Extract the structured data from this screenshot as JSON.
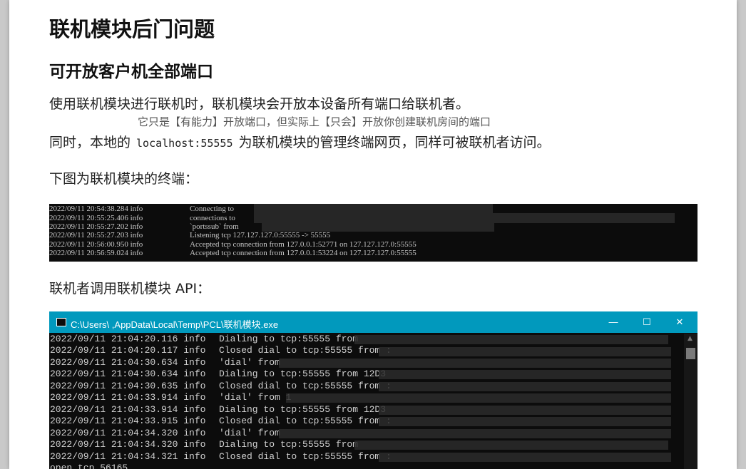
{
  "heading": "联机模块后门问题",
  "subheading": "可开放客户机全部端口",
  "para1": "使用联机模块进行联机时，联机模块会开放本设备所有端口给联机者。",
  "note": "它只是【有能力】开放端口，但实际上【只会】开放你创建联机房间的端口",
  "para2": {
    "before": "同时，本地的",
    "code": "localhost:55555",
    "after": "为联机模块的管理终端网页，同样可被联机者访问。"
  },
  "caption1": "下图为联机模块的终端：",
  "terminal1": [
    {
      "time": "2022/09/11 20:54:38.284 info",
      "msg": "Connecting to"
    },
    {
      "time": "2022/09/11 20:55:25.406 info",
      "msg": "connections to"
    },
    {
      "time": "2022/09/11 20:55:27.202 info",
      "msg": "`portssub` from"
    },
    {
      "time": "2022/09/11 20:55:27.203 info",
      "msg": "Listening tcp 127.127.127.0:55555 -> 55555"
    },
    {
      "time": "2022/09/11 20:56:00.950 info",
      "msg": "Accepted tcp connection from 127.0.0.1:52771 on 127.127.127.0:55555"
    },
    {
      "time": "2022/09/11 20:56:59.024 info",
      "msg": "Accepted tcp connection from 127.0.0.1:53224 on 127.127.127.0:55555"
    }
  ],
  "caption2": "联机者调用联机模块 API：",
  "window": {
    "title": "C:\\Users\\       ,AppData\\Local\\Temp\\PCL\\联机模块.exe",
    "minimize": "—",
    "maximize": "☐",
    "close": "✕"
  },
  "terminal2": [
    {
      "time": "2022/09/11 21:04:20.116 info",
      "msg": "Dialing to tcp:55555 from"
    },
    {
      "time": "2022/09/11 21:04:20.117 info",
      "msg": "Closed dial to tcp:55555 from :"
    },
    {
      "time": "2022/09/11 21:04:30.634 info",
      "msg": "'dial' from"
    },
    {
      "time": "2022/09/11 21:04:30.634 info",
      "msg": "Dialing to tcp:55555 from 12D3"
    },
    {
      "time": "2022/09/11 21:04:30.635 info",
      "msg": "Closed dial to tcp:55555 from :"
    },
    {
      "time": "2022/09/11 21:04:33.914 info",
      "msg": "'dial' from 1"
    },
    {
      "time": "2022/09/11 21:04:33.914 info",
      "msg": "Dialing to tcp:55555 from 12D3"
    },
    {
      "time": "2022/09/11 21:04:33.915 info",
      "msg": "Closed dial to tcp:55555 from :"
    },
    {
      "time": "2022/09/11 21:04:34.320 info",
      "msg": "'dial' from"
    },
    {
      "time": "2022/09/11 21:04:34.320 info",
      "msg": "Dialing to tcp:55555 from"
    },
    {
      "time": "2022/09/11 21:04:34.321 info",
      "msg": "Closed dial to tcp:55555 from :"
    },
    {
      "time": "open tcp 56165",
      "msg": ""
    }
  ]
}
